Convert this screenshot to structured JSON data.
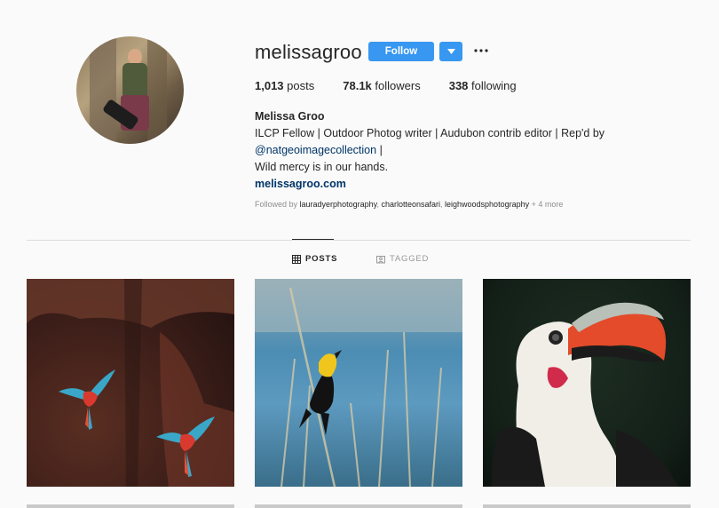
{
  "profile": {
    "username": "melissagroo",
    "follow_label": "Follow",
    "stats": {
      "posts_count": "1,013",
      "posts_label": "posts",
      "followers_count": "78.1k",
      "followers_label": "followers",
      "following_count": "338",
      "following_label": "following"
    },
    "bio": {
      "name": "Melissa Groo",
      "line1": "ILCP Fellow | Outdoor Photog writer | Audubon contrib editor | Rep'd by",
      "mention": "@natgeoimagecollection",
      "mention_suffix": " |",
      "line3": "Wild mercy is in our hands.",
      "website": "melissagroo.com"
    },
    "followed_by": {
      "prefix": "Followed by ",
      "accounts": [
        "lauradyerphotography",
        "charlotteonsafari",
        "leighwoodsphotography"
      ],
      "more": " + 4 more"
    }
  },
  "tabs": [
    {
      "label": "POSTS",
      "active": true,
      "icon": "grid-icon"
    },
    {
      "label": "TAGGED",
      "active": false,
      "icon": "tag-icon"
    }
  ],
  "posts": [
    {
      "subject": "macaws"
    },
    {
      "subject": "yellow-headed-blackbird"
    },
    {
      "subject": "hornbill"
    }
  ],
  "colors": {
    "accent": "#3897f0",
    "link": "#003569",
    "muted": "#8e8e8e"
  }
}
